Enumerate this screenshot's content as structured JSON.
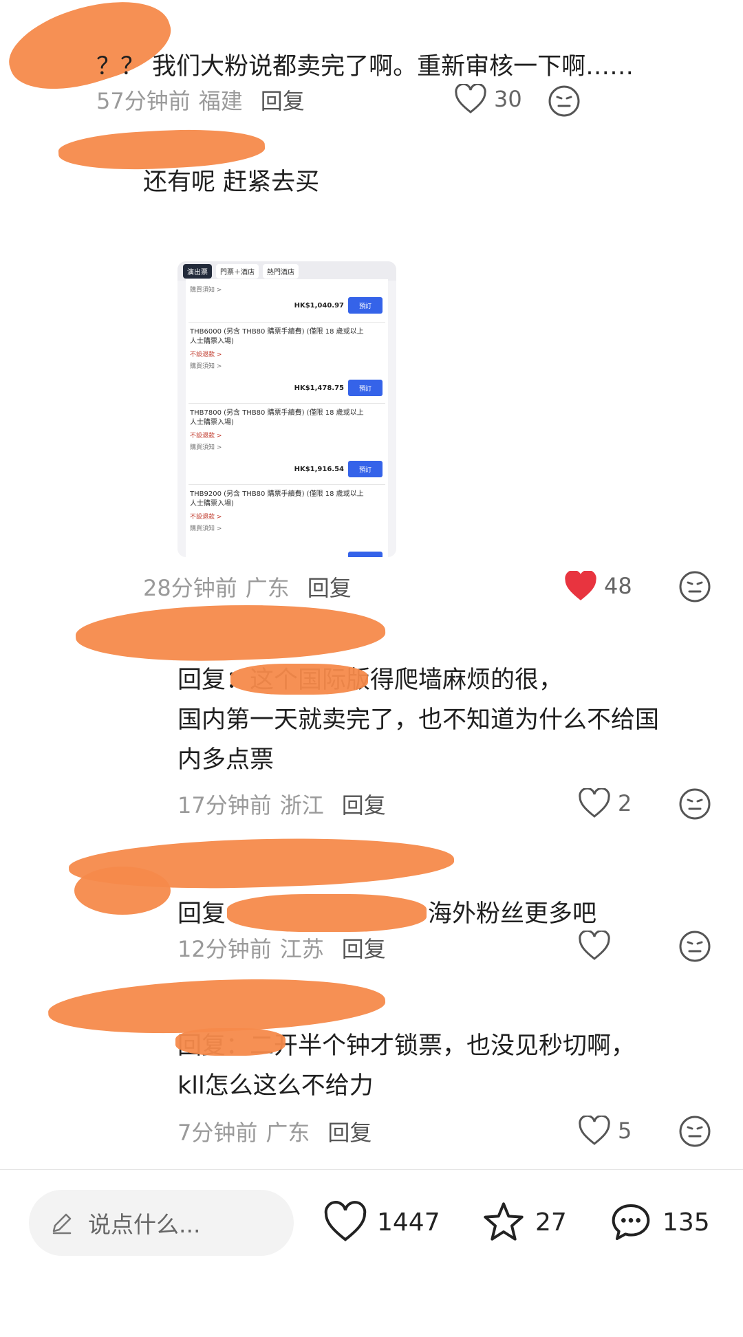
{
  "comments": [
    {
      "text": "？？ 我们大粉说都卖完了啊。重新审核一下啊……",
      "time": "57分钟前",
      "region": "福建",
      "reply_label": "回复",
      "likes": "30",
      "liked": false
    },
    {
      "text": "还有呢  赶紧去买",
      "time": "28分钟前",
      "region": "广东",
      "reply_label": "回复",
      "likes": "48",
      "liked": true
    },
    {
      "text_line1": "回复：这个国际版得爬墙麻烦的很，",
      "text_line2": "国内第一天就卖完了，也不知道为什么不给国",
      "text_line3": "内多点票",
      "time": "17分钟前",
      "region": "浙江",
      "reply_label": "回复",
      "likes": "2",
      "liked": false
    },
    {
      "text_prefix": "回复",
      "text_suffix": "海外粉丝更多吧",
      "time": "12分钟前",
      "region": "江苏",
      "reply_label": "回复",
      "likes": "",
      "liked": false
    },
    {
      "text_line1": "回复：二开半个钟才锁票，也没见秒切啊，",
      "text_line2": "kll怎么这么不给力",
      "time": "7分钟前",
      "region": "广东",
      "reply_label": "回复",
      "likes": "5",
      "liked": false
    }
  ],
  "embedded_screenshot": {
    "tabs": [
      "演出票",
      "門票＋酒店",
      "熱門酒店"
    ],
    "notice_label": "購買須知 >",
    "refund_label": "不設退款 >",
    "book_label": "預訂",
    "first_price": "HK$1,040.97",
    "items": [
      {
        "desc1": "THB6000 (另含 THB80 購票手續費) (僅限 18 歲或以上",
        "desc2": "人士購票入場)",
        "price": "HK$1,478.75"
      },
      {
        "desc1": "THB7800 (另含 THB80 購票手續費) (僅限 18 歲或以上",
        "desc2": "人士購票入場)",
        "price": "HK$1,916.54"
      },
      {
        "desc1": "THB9200 (另含 THB80 購票手續費) (僅限 18 歲或以上",
        "desc2": "人士購票入場)",
        "price": ""
      }
    ]
  },
  "bottom_bar": {
    "input_placeholder": "说点什么...",
    "likes_count": "1447",
    "stars_count": "27",
    "comments_count": "135"
  },
  "colors": {
    "liked_red": "#e8343f",
    "redaction_orange": "#f58a4b",
    "book_button_blue": "#3563e9"
  }
}
